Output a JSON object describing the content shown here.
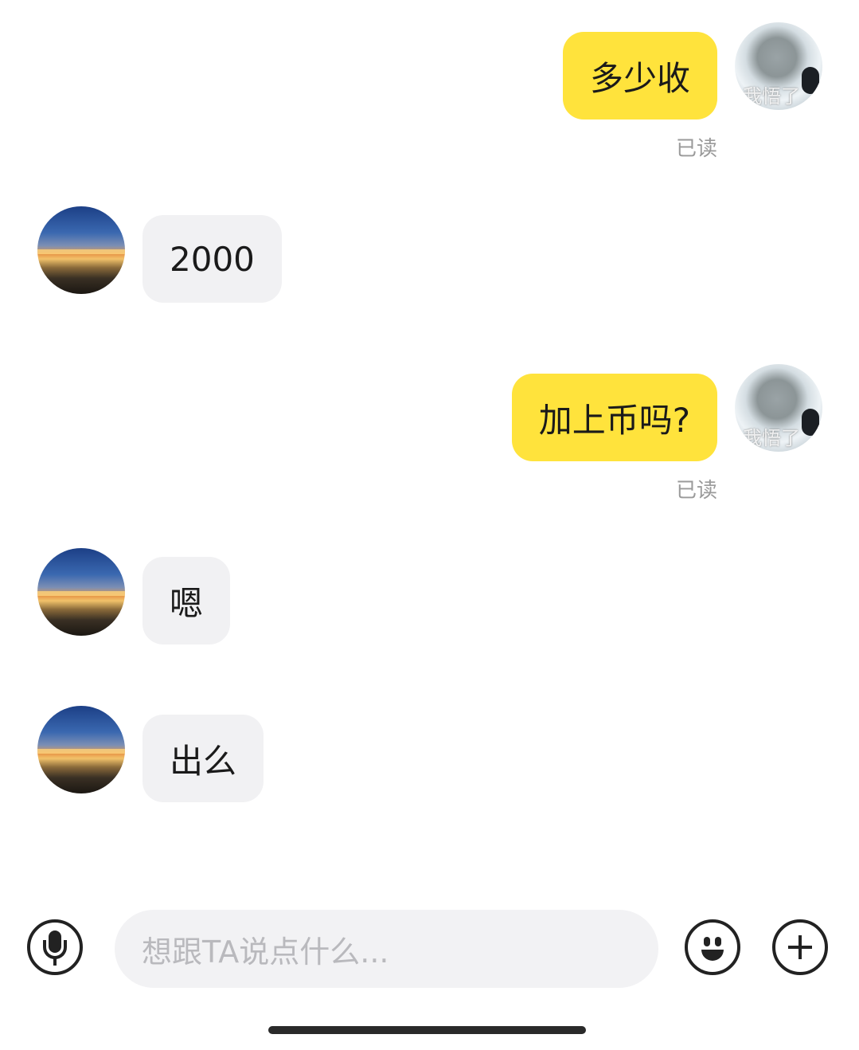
{
  "chat": {
    "messages": [
      {
        "sender": "me",
        "text": "多少收",
        "status": "已读",
        "avatar_watermark": "我悟了"
      },
      {
        "sender": "other",
        "text": "2000"
      },
      {
        "sender": "me",
        "text": "加上币吗?",
        "status": "已读",
        "avatar_watermark": "我悟了"
      },
      {
        "sender": "other",
        "text": "嗯"
      },
      {
        "sender": "other",
        "text": "出么"
      }
    ]
  },
  "input_bar": {
    "placeholder": "想跟TA说点什么...",
    "icons": {
      "voice": "microphone-icon",
      "emoji": "smiley-face-icon",
      "more": "plus-icon"
    }
  },
  "colors": {
    "my_bubble": "#ffe33c",
    "their_bubble": "#f1f1f3",
    "read_status": "#9a9a9a",
    "placeholder": "#b9b9bd"
  }
}
